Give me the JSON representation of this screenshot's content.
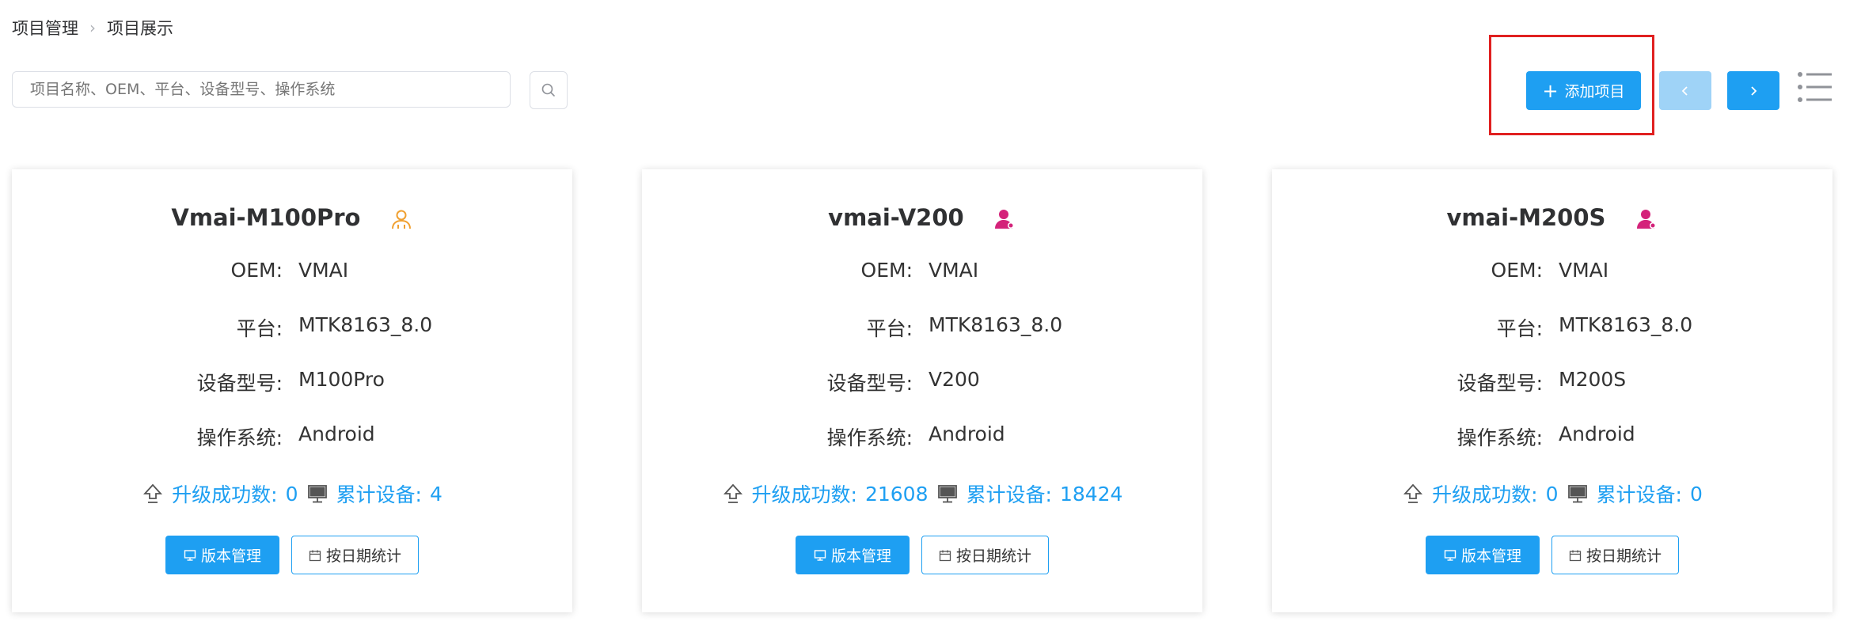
{
  "breadcrumb": {
    "items": [
      "项目管理",
      "项目展示"
    ]
  },
  "search": {
    "placeholder": "项目名称、OEM、平台、设备型号、操作系统"
  },
  "toolbar": {
    "add_label": "添加项目",
    "prev_label": "‹",
    "next_label": "›"
  },
  "labels": {
    "oem": "OEM:",
    "platform": "平台:",
    "model": "设备型号:",
    "os": "操作系统:",
    "upgrade": "升级成功数:",
    "devices": "累计设备:",
    "version_btn": "版本管理",
    "date_btn": "按日期统计"
  },
  "colors": {
    "primary": "#1e9ff2",
    "owner_icon": "#f0a030",
    "member_icon": "#d4237a",
    "highlight": "#e02020"
  },
  "projects": [
    {
      "name": "Vmai-M100Pro",
      "icon": "person-outline-icon",
      "oem": "VMAI",
      "platform": "MTK8163_8.0",
      "model": "M100Pro",
      "os": "Android",
      "upgrade_count": "0",
      "device_count": "4"
    },
    {
      "name": "vmai-V200",
      "icon": "person-filled-icon",
      "oem": "VMAI",
      "platform": "MTK8163_8.0",
      "model": "V200",
      "os": "Android",
      "upgrade_count": "21608",
      "device_count": "18424"
    },
    {
      "name": "vmai-M200S",
      "icon": "person-filled-icon",
      "oem": "VMAI",
      "platform": "MTK8163_8.0",
      "model": "M200S",
      "os": "Android",
      "upgrade_count": "0",
      "device_count": "0"
    }
  ]
}
